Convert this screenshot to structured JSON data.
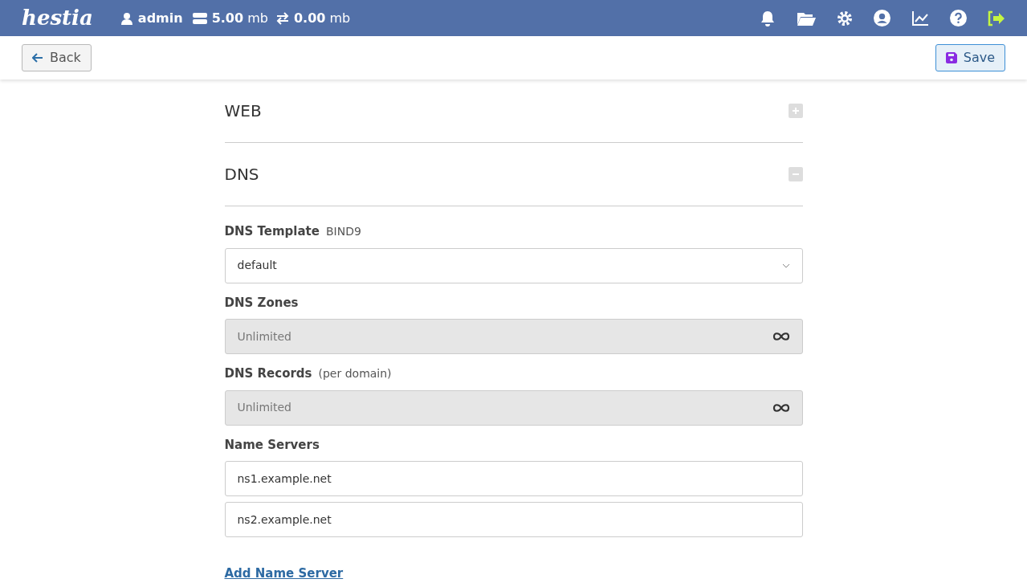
{
  "header": {
    "logo": "hestia",
    "user": "admin",
    "disk": {
      "value": "5.00",
      "unit": "mb"
    },
    "bandwidth": {
      "value": "0.00",
      "unit": "mb"
    }
  },
  "toolbar": {
    "back": "Back",
    "save": "Save"
  },
  "sections": [
    {
      "title": "WEB",
      "expanded": false
    },
    {
      "title": "DNS",
      "expanded": true
    }
  ],
  "fields": [
    {
      "kind": "select",
      "label": "DNS Template",
      "hint": "BIND9",
      "value": "default"
    },
    {
      "kind": "limit",
      "label": "DNS Zones",
      "value": "Unlimited",
      "disabled": true
    },
    {
      "kind": "limit",
      "label": "DNS Records",
      "hint": "(per domain)",
      "value": "Unlimited",
      "disabled": true
    },
    {
      "kind": "list",
      "label": "Name Servers",
      "values": [
        "ns1.example.net",
        "ns2.example.net"
      ]
    }
  ],
  "add_link": "Add Name Server"
}
